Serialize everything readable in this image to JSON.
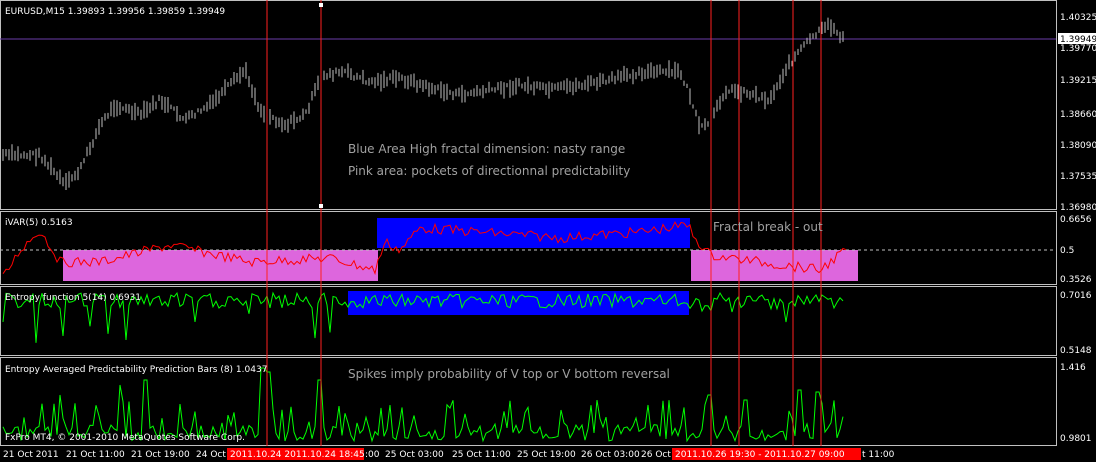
{
  "panels": {
    "main": {
      "title": "EURUSD,M15  1.39893 1.39956 1.39859 1.39949",
      "prices": [
        "1.40325",
        "1.39770",
        "1.39215",
        "1.38660",
        "1.38090",
        "1.37535",
        "1.36980"
      ],
      "current_price": "1.39949",
      "annotation_1": "Blue Area High fractal dimension: nasty range",
      "annotation_2": "Pink area: pockets of directionnal predictability"
    },
    "ivar": {
      "title": "iVAR(5) 0.5163",
      "levels": [
        "0.6656",
        "0.5",
        "0.3526"
      ],
      "annotation": "Fractal break - out"
    },
    "entropy": {
      "title": "Entropy function 5(14) 0.6931",
      "levels": [
        "0.7016",
        "0.5148"
      ]
    },
    "prediction": {
      "title": "Entropy Averaged Predictability Prediction Bars (8) 1.0437",
      "levels": [
        "1.416",
        "0.9801"
      ],
      "annotation": "Spikes imply probability of V top or V bottom reversal",
      "copyright": "FxPro MT4, © 2001-2010 MetaQuotes Software Corp."
    }
  },
  "time_axis": [
    "21 Oct 2011",
    "21 Oct 11:00",
    "21 Oct 19:00",
    "24 Oct",
    "2011.10.24  2011.10.24 18:45",
    ":00",
    "25 Oct 03:00",
    "25 Oct 11:00",
    "25 Oct 19:00",
    "26 Oct 03:00",
    "26 Oct",
    "2011.10.26 19:30 - 2011.10.27 09:00",
    "t 11:00"
  ],
  "colors": {
    "background": "#000000",
    "price_line": "#c0c0c0",
    "indicator_red": "#ff0000",
    "indicator_green": "#00ff00",
    "blue_area": "#0000ff",
    "pink_area": "#dd66dd",
    "marker_line": "#ff2020",
    "grid_purple": "#6a3ca8",
    "annotation_text": "#a0a0a0"
  }
}
